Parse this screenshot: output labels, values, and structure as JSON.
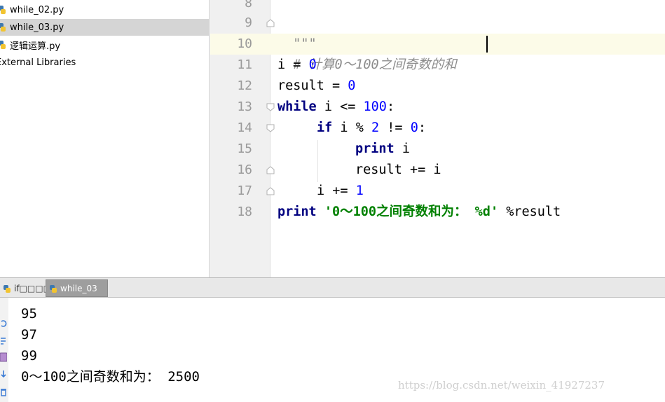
{
  "project_tree": {
    "items": [
      {
        "label": "while_02.py",
        "selected": false
      },
      {
        "label": "while_03.py",
        "selected": true
      },
      {
        "label": "逻辑运算.py",
        "selected": false
      }
    ],
    "external_libraries": "External Libraries"
  },
  "editor": {
    "line_numbers": [
      "8",
      "9",
      "10",
      "11",
      "12",
      "13",
      "14",
      "15",
      "16",
      "17",
      "18"
    ],
    "code": {
      "l9_docstring": "\"\"\"",
      "l10_comment": "# 计算0～100之间奇数的和",
      "l11_var": "i",
      "l11_op": " = ",
      "l11_num": "0",
      "l12_var": "result",
      "l12_op": " = ",
      "l12_num": "0",
      "l13_kw": "while",
      "l13_cond": " i <= ",
      "l13_num": "100",
      "l13_end": ":",
      "l14_kw": "if",
      "l14_cond": " i % ",
      "l14_num1": "2",
      "l14_op": " != ",
      "l14_num2": "0",
      "l14_end": ":",
      "l15_kw": "print",
      "l15_rest": " i",
      "l16_text": "result += i",
      "l17_text": "i += ",
      "l17_num": "1",
      "l18_kw": "print",
      "l18_str": " '0～100之间奇数和为： %d'",
      "l18_rest": " %result"
    }
  },
  "run_tabs": [
    {
      "label": "if□□□□",
      "active": false
    },
    {
      "label": "while_03",
      "active": true
    }
  ],
  "console": {
    "lines": [
      "95",
      "97",
      "99",
      "0～100之间奇数和为： 2500"
    ],
    "watermark": "https://blog.csdn.net/weixin_41927237"
  },
  "colors": {
    "keyword": "#000080",
    "number": "#0000ff",
    "comment": "#8c8c8c",
    "string": "#008000",
    "selected_row": "#d5d5d5",
    "caret_line": "#fcfbe8"
  }
}
